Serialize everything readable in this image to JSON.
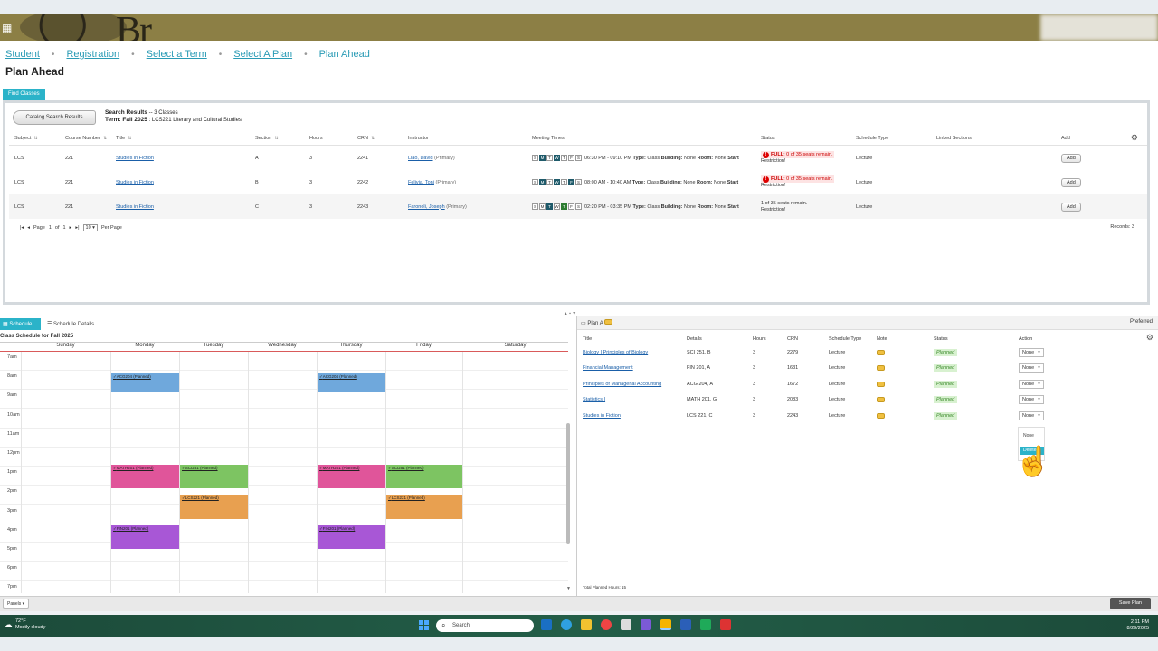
{
  "header": {
    "brand_text": "Br"
  },
  "breadcrumb": [
    "Student",
    "Registration",
    "Select a Term",
    "Select A Plan",
    "Plan Ahead"
  ],
  "page_title": "Plan Ahead",
  "find_tab": "Find Classes",
  "search": {
    "catalog_button": "Catalog Search Results",
    "results_title": "Search Results",
    "results_count": "-- 3 Classes",
    "term_label": "Term: Fall 2025",
    "term_course": ": LCS221 Literary and Cultural Studies",
    "columns": [
      "Subject",
      "Course Number",
      "Title",
      "Section",
      "Hours",
      "CRN",
      "Instructor",
      "Meeting Times",
      "Status",
      "Schedule Type",
      "Linked Sections",
      "Add"
    ],
    "rows": [
      {
        "subject": "LCS",
        "course": "221",
        "title": "Studies in Fiction",
        "section": "A",
        "hours": "3",
        "crn": "2241",
        "instructor": "Liao, David",
        "primary": "(Primary)",
        "days_on": [
          1,
          3
        ],
        "time": "06:30 PM - 09:10 PM",
        "type_lbl": "Type:",
        "type": "Class",
        "bldg_lbl": "Building:",
        "bldg": "None",
        "room_lbl": "Room:",
        "room": "None",
        "start_lbl": "Start",
        "status_full": "FULL",
        "status_text": ": 0 of 35 seats remain.",
        "restriction": "Restriction!",
        "sched_type": "Lecture",
        "add": "Add"
      },
      {
        "subject": "LCS",
        "course": "221",
        "title": "Studies in Fiction",
        "section": "B",
        "hours": "3",
        "crn": "2242",
        "instructor": "Felivia, Toni",
        "primary": "(Primary)",
        "days_on": [
          1,
          3,
          5
        ],
        "time": "08:00 AM - 10:40 AM",
        "type_lbl": "Type:",
        "type": "Class",
        "bldg_lbl": "Building:",
        "bldg": "None",
        "room_lbl": "Room:",
        "room": "None",
        "start_lbl": "Start",
        "status_full": "FULL",
        "status_text": ": 0 of 35 seats remain.",
        "restriction": "Restriction!",
        "sched_type": "Lecture",
        "add": "Add"
      },
      {
        "subject": "LCS",
        "course": "221",
        "title": "Studies in Fiction",
        "section": "C",
        "hours": "3",
        "crn": "2243",
        "instructor": "Faronoli, Joseph",
        "primary": "(Primary)",
        "days_on": [
          2,
          4
        ],
        "time": "02:20 PM - 03:35 PM",
        "type_lbl": "Type:",
        "type": "Class",
        "bldg_lbl": "Building:",
        "bldg": "None",
        "room_lbl": "Room:",
        "room": "None",
        "start_lbl": "Start",
        "status_full": "",
        "status_text": "1 of 35 seats remain.",
        "restriction": "Restriction!",
        "sched_type": "Lecture",
        "add": "Add"
      }
    ],
    "day_letters": [
      "S",
      "M",
      "T",
      "W",
      "T",
      "F",
      "S"
    ],
    "pager": {
      "page_label": "Page",
      "page_num": "1",
      "of": "of",
      "total": "1",
      "per_page_value": "10",
      "per_page_label": "Per Page"
    },
    "records": "Records: 3"
  },
  "schedule": {
    "tab_schedule": "Schedule",
    "tab_details": "Schedule Details",
    "label": "Class Schedule for Fall 2025",
    "days": [
      "Sunday",
      "Monday",
      "Tuesday",
      "Wednesday",
      "Thursday",
      "Friday",
      "Saturday"
    ],
    "hours": [
      "7am",
      "8am",
      "9am",
      "10am",
      "11am",
      "12pm",
      "1pm",
      "2pm",
      "3pm",
      "4pm",
      "5pm",
      "6pm",
      "7pm"
    ],
    "events": [
      {
        "label": "ACG204 (Planned)",
        "day": 1,
        "start": 8.0,
        "end": 9.0,
        "color": "#6fa8dc"
      },
      {
        "label": "ACG204 (Planned)",
        "day": 4,
        "start": 8.0,
        "end": 9.0,
        "color": "#6fa8dc"
      },
      {
        "label": "MATH201 (Planned)",
        "day": 1,
        "start": 12.75,
        "end": 14.0,
        "color": "#e0559a"
      },
      {
        "label": "MATH201 (Planned)",
        "day": 4,
        "start": 12.75,
        "end": 14.0,
        "color": "#e0559a"
      },
      {
        "label": "SCI251 (Planned)",
        "day": 2,
        "start": 12.75,
        "end": 14.0,
        "color": "#7dc462"
      },
      {
        "label": "SCI251 (Planned)",
        "day": 5,
        "start": 12.75,
        "end": 14.0,
        "color": "#7dc462"
      },
      {
        "label": "LCS221 (Planned)",
        "day": 2,
        "start": 14.33,
        "end": 15.58,
        "color": "#e8a050"
      },
      {
        "label": "LCS221 (Planned)",
        "day": 5,
        "start": 14.33,
        "end": 15.58,
        "color": "#e8a050"
      },
      {
        "label": "FIN201 (Planned)",
        "day": 1,
        "start": 15.9,
        "end": 17.15,
        "color": "#a857d6"
      },
      {
        "label": "FIN201 (Planned)",
        "day": 4,
        "start": 15.9,
        "end": 17.15,
        "color": "#a857d6"
      }
    ]
  },
  "plan": {
    "name": "Plan A",
    "preferred": "Preferred",
    "columns": [
      "Title",
      "Details",
      "Hours",
      "CRN",
      "Schedule Type",
      "Note",
      "Status",
      "Action"
    ],
    "rows": [
      {
        "title": "Biology I Principles of Biology",
        "details": "SCI 251, B",
        "hours": "3",
        "crn": "2279",
        "sched_type": "Lecture",
        "status": "Planned",
        "action": "None"
      },
      {
        "title": "Financial Management",
        "details": "FIN 201, A",
        "hours": "3",
        "crn": "1631",
        "sched_type": "Lecture",
        "status": "Planned",
        "action": "None"
      },
      {
        "title": "Principles of Managerial Accounting",
        "details": "ACG 204, A",
        "hours": "3",
        "crn": "1672",
        "sched_type": "Lecture",
        "status": "Planned",
        "action": "None"
      },
      {
        "title": "Statistics I",
        "details": "MATH 201, G",
        "hours": "3",
        "crn": "2083",
        "sched_type": "Lecture",
        "status": "Planned",
        "action": "None"
      },
      {
        "title": "Studies in Fiction",
        "details": "LCS 221, C",
        "hours": "3",
        "crn": "2243",
        "sched_type": "Lecture",
        "status": "Planned",
        "action": "None"
      }
    ],
    "dropdown_options": [
      "None",
      "Delete"
    ],
    "total_hours": "Total Planned Hours: 15"
  },
  "footer": {
    "panels": "Panels",
    "save_plan": "Save Plan"
  },
  "taskbar": {
    "temp": "72°F",
    "weather": "Mostly cloudy",
    "search": "Search",
    "time": "2:11 PM",
    "date": "8/29/2025"
  }
}
